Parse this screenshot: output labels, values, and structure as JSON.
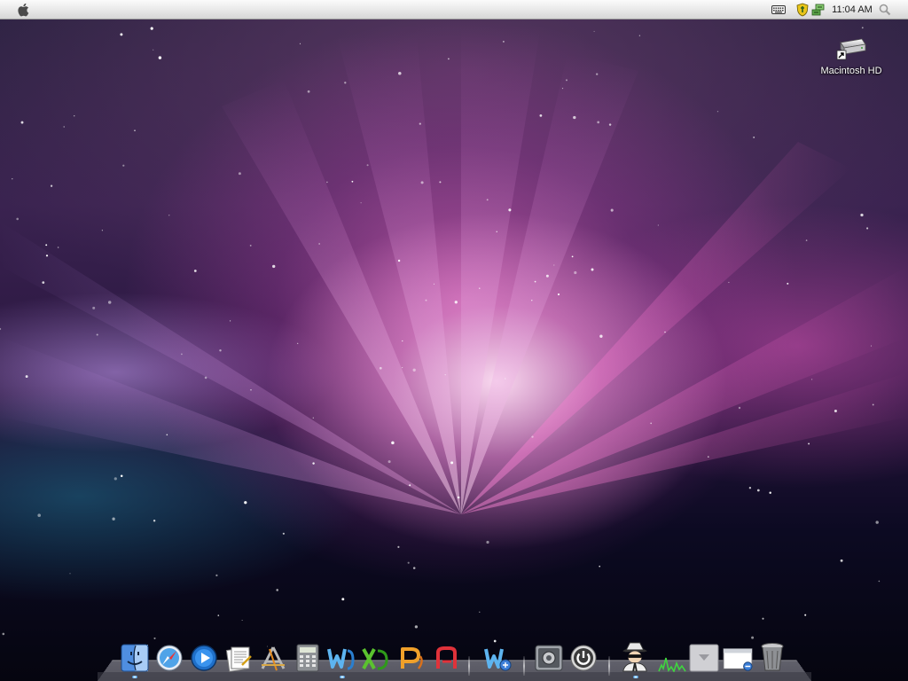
{
  "menubar": {
    "apple_icon": "apple-icon",
    "tray": {
      "keyboard_icon": "keyboard-icon",
      "security_icon": "shield-icon",
      "network_icon": "network-icon"
    },
    "clock": "11:04 AM",
    "spotlight_icon": "search-icon"
  },
  "desktop": {
    "icons": [
      {
        "label": "Macintosh HD",
        "icon": "hard-drive-icon"
      }
    ]
  },
  "dock": {
    "items": [
      {
        "icon": "finder-icon",
        "running": true
      },
      {
        "icon": "safari-icon",
        "running": false
      },
      {
        "icon": "media-player-icon",
        "running": false
      },
      {
        "icon": "document-editor-icon",
        "running": false
      },
      {
        "icon": "app-store-icon",
        "running": false
      },
      {
        "icon": "calculator-icon",
        "running": false
      },
      {
        "icon": "word-icon",
        "running": false
      },
      {
        "icon": "excel-icon",
        "running": false
      },
      {
        "icon": "powerpoint-icon",
        "running": false
      },
      {
        "icon": "access-icon",
        "running": false
      },
      {
        "icon": "messenger-icon",
        "running": false
      },
      {
        "icon": "system-preferences-icon",
        "running": false
      },
      {
        "icon": "power-icon",
        "running": false
      },
      {
        "icon": "spy-agent-icon",
        "running": true
      },
      {
        "icon": "activity-monitor-icon",
        "running": false
      },
      {
        "icon": "downloads-stack-icon",
        "running": false
      },
      {
        "icon": "window-manager-icon",
        "running": false
      },
      {
        "icon": "trash-icon",
        "running": false
      }
    ]
  },
  "colors": {
    "menubar": "#e6e6e6",
    "wallpaper_glow": "#f0a0d8",
    "wallpaper_dark": "#07071a",
    "run_indicator": "#5ab0ff"
  }
}
